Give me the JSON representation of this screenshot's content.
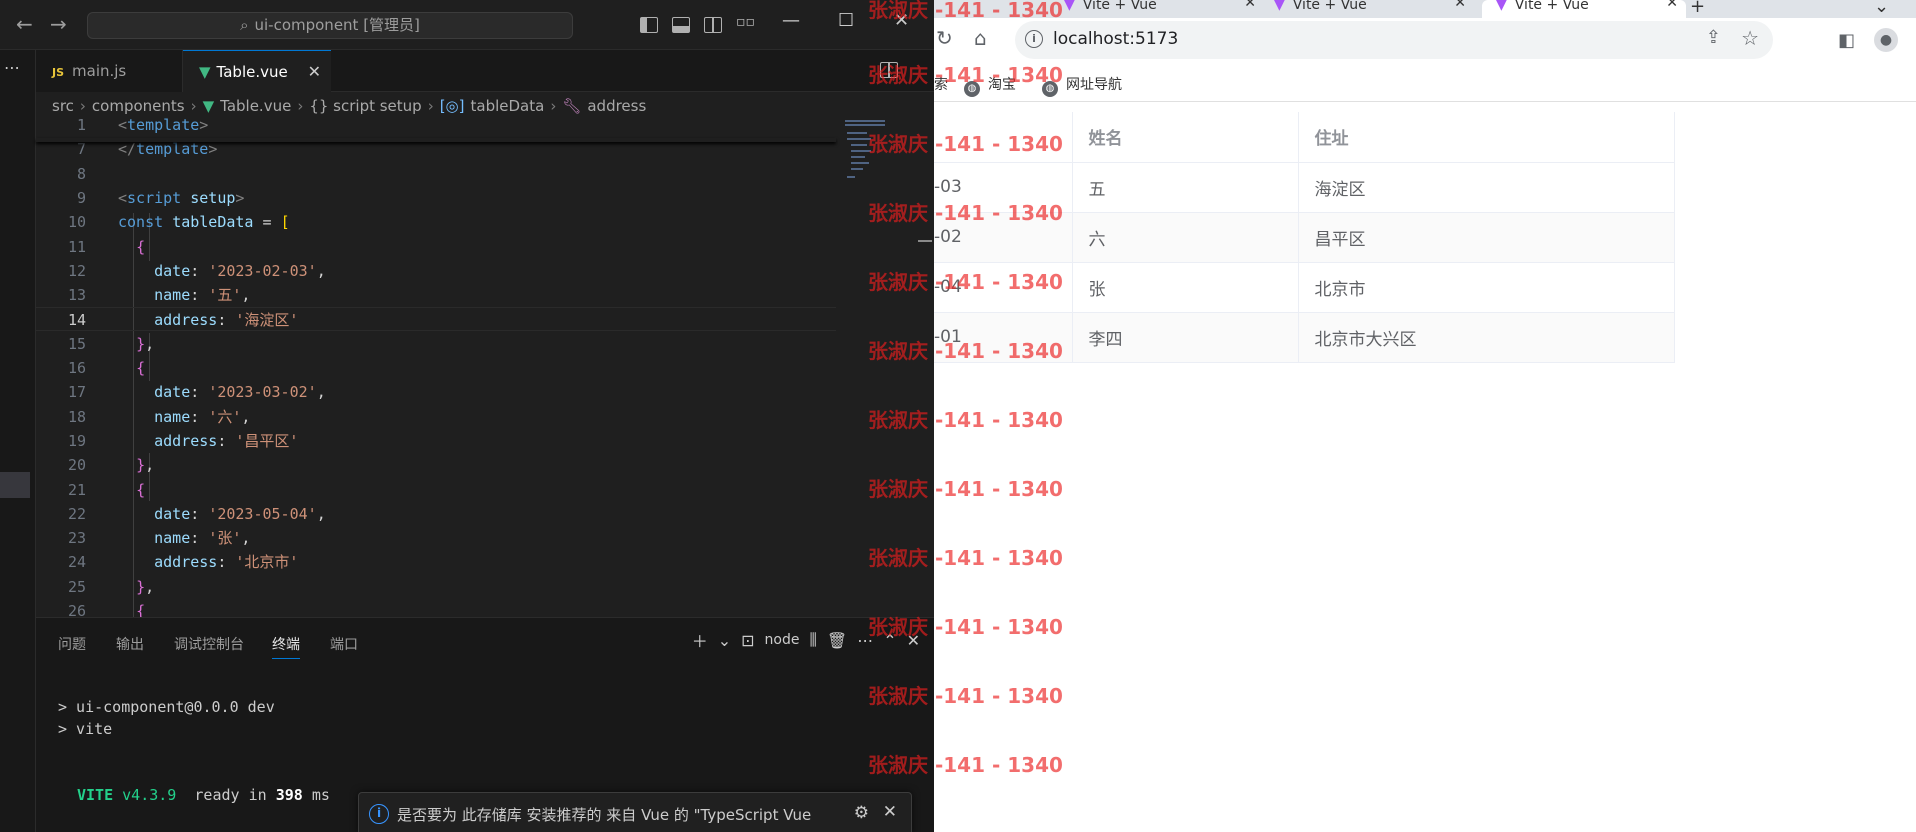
{
  "vscode": {
    "title": "ui-component [管理员]",
    "tabs": [
      {
        "label": "main.js",
        "icon": "JS"
      },
      {
        "label": "Table.vue"
      }
    ],
    "breadcrumb": [
      "src",
      "components",
      "Table.vue",
      "{} script setup",
      "tableData",
      "address"
    ],
    "code_lines": [
      {
        "n": "1",
        "text": "<template>"
      },
      {
        "n": "7",
        "text": "</template>"
      },
      {
        "n": "8",
        "text": ""
      },
      {
        "n": "9",
        "text": "<script setup>"
      },
      {
        "n": "10",
        "text": "const tableData = ["
      },
      {
        "n": "11",
        "text": "  {"
      },
      {
        "n": "12",
        "text": "    date: '2023-02-03',"
      },
      {
        "n": "13",
        "text": "    name: '五',"
      },
      {
        "n": "14",
        "text": "    address: '海淀区'"
      },
      {
        "n": "15",
        "text": "  },"
      },
      {
        "n": "16",
        "text": "  {"
      },
      {
        "n": "17",
        "text": "    date: '2023-03-02',"
      },
      {
        "n": "18",
        "text": "    name: '六',"
      },
      {
        "n": "19",
        "text": "    address: '昌平区'"
      },
      {
        "n": "20",
        "text": "  },"
      },
      {
        "n": "21",
        "text": "  {"
      },
      {
        "n": "22",
        "text": "    date: '2023-05-04',"
      },
      {
        "n": "23",
        "text": "    name: '张',"
      },
      {
        "n": "24",
        "text": "    address: '北京市'"
      },
      {
        "n": "25",
        "text": "  },"
      },
      {
        "n": "26",
        "text": "  {"
      }
    ],
    "active_line": "14",
    "panel": {
      "tabs": [
        "问题",
        "输出",
        "调试控制台",
        "终端",
        "端口"
      ],
      "active_tab": "终端",
      "terminal_name": "node",
      "terminal_lines": [
        "> ui-component@0.0.0 dev",
        "> vite"
      ],
      "vite_label": "VITE",
      "vite_version": "v4.3.9",
      "ready_text": "ready in",
      "ready_ms": "398",
      "ms_unit": "ms"
    },
    "notification": "是否要为 此存储库 安装推荐的 来自 Vue 的 \"TypeScript Vue"
  },
  "chrome": {
    "tabs": [
      "Vite + Vue",
      "Vite + Vue",
      "Vite + Vue"
    ],
    "url": "localhost:5173",
    "bookmarks": [
      "索",
      "淘宝",
      "网址导航"
    ],
    "table": {
      "headers": [
        "",
        "姓名",
        "住址"
      ],
      "rows": [
        [
          "-03",
          "五",
          "海淀区"
        ],
        [
          "-02",
          "六",
          "昌平区"
        ],
        [
          "-04",
          "张",
          "北京市"
        ],
        [
          "-01",
          "李四",
          "北京市大兴区"
        ]
      ]
    }
  },
  "watermark": "张淑庆 -141 - 1340",
  "colors": {
    "vscode_bg": "#1f1f1f",
    "accent": "#0078d4",
    "vue_green": "#41b883",
    "vite_green": "#23d18b",
    "watermark_red": "#eb1e1e"
  }
}
